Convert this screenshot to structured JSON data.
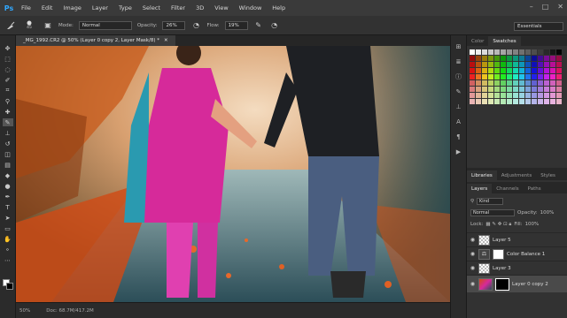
{
  "app": {
    "logo": "Ps"
  },
  "menu": [
    "File",
    "Edit",
    "Image",
    "Layer",
    "Type",
    "Select",
    "Filter",
    "3D",
    "View",
    "Window",
    "Help"
  ],
  "window_controls": [
    "–",
    "□",
    "✕"
  ],
  "options": {
    "brush_size": "45",
    "mode_label": "Mode:",
    "mode_value": "Normal",
    "opacity_label": "Opacity:",
    "opacity_value": "26%",
    "flow_label": "Flow:",
    "flow_value": "19%",
    "workspace": "Essentials"
  },
  "document": {
    "tab_title": "_MG_1992.CR2 @ 50% (Layer 0 copy 2, Layer Mask/8) *",
    "close": "✕",
    "zoom": "50%",
    "doc_info": "Doc: 68.7M/417.2M"
  },
  "color_panel": {
    "tabs": [
      "Color",
      "Swatches"
    ],
    "active_tab": "Swatches"
  },
  "libraries_panel": {
    "tabs": [
      "Libraries",
      "Adjustments",
      "Styles"
    ]
  },
  "layers_panel": {
    "tabs": [
      "Layers",
      "Channels",
      "Paths"
    ],
    "kind_label": "Kind",
    "blend_mode": "Normal",
    "opacity_label": "Opacity:",
    "opacity_value": "100%",
    "lock_label": "Lock:",
    "fill_label": "Fill:",
    "fill_value": "100%",
    "layers": [
      {
        "name": "Layer 5",
        "selected": false
      },
      {
        "name": "Color Balance 1",
        "selected": false
      },
      {
        "name": "Layer 3",
        "selected": false
      },
      {
        "name": "Layer 0 copy 2",
        "selected": true
      }
    ]
  }
}
